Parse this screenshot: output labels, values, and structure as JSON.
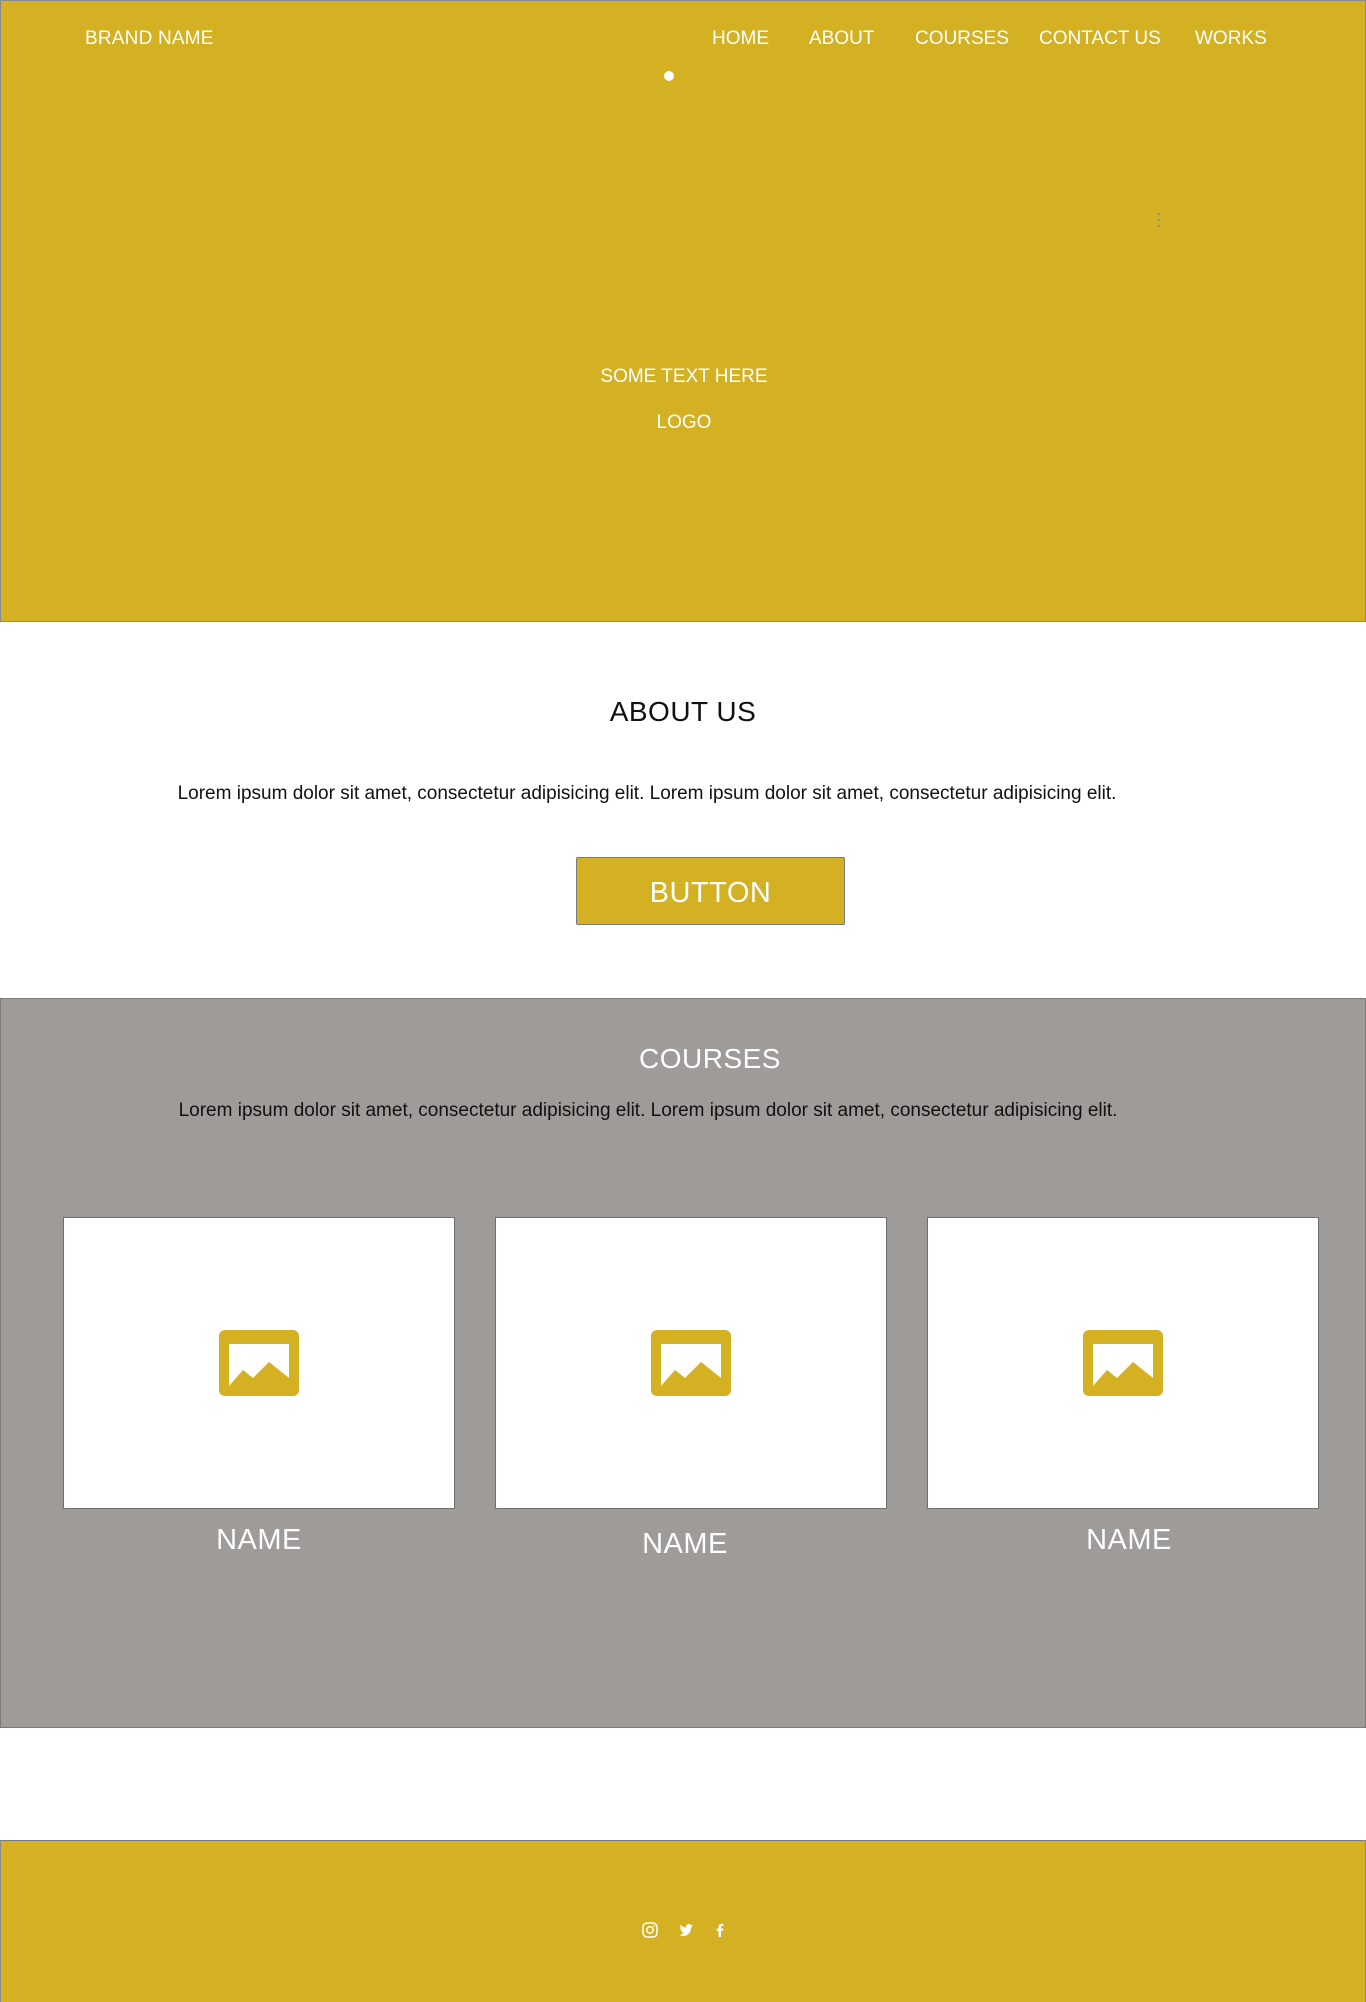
{
  "header": {
    "brand": "BRAND NAME",
    "nav": {
      "home": "HOME",
      "about": "ABOUT",
      "courses": "COURSES",
      "contact": "CONTACT US",
      "works": "WORKS"
    }
  },
  "hero": {
    "text": "SOME TEXT HERE",
    "logo": "LOGO"
  },
  "about": {
    "title": "ABOUT US",
    "text": "Lorem ipsum dolor sit amet, consectetur adipisicing elit. Lorem ipsum dolor sit amet, consectetur adipisicing elit.",
    "button": "BUTTON"
  },
  "courses": {
    "title": "COURSES",
    "text": "Lorem ipsum dolor sit amet, consectetur adipisicing elit. Lorem ipsum dolor sit amet, consectetur adipisicing elit.",
    "cards": [
      {
        "name": "NAME",
        "icon": "image-placeholder-icon"
      },
      {
        "name": "NAME",
        "icon": "image-placeholder-icon"
      },
      {
        "name": "NAME",
        "icon": "image-placeholder-icon"
      }
    ]
  },
  "footer": {
    "social": [
      "instagram-icon",
      "twitter-icon",
      "facebook-icon"
    ]
  },
  "colors": {
    "accent": "#d4b023",
    "courses_bg": "#9e9b99",
    "white": "#ffffff"
  }
}
